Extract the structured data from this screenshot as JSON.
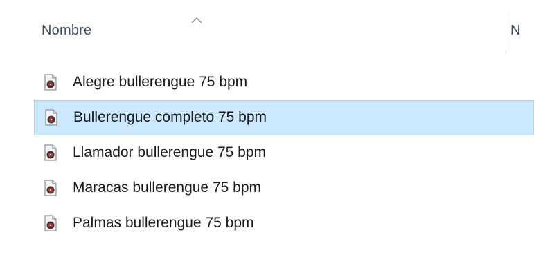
{
  "columns": {
    "name_header": "Nombre",
    "next_header": "N",
    "sort_indicator": "chevron-up-icon"
  },
  "files": [
    {
      "name": "Alegre bullerengue 75 bpm",
      "icon": "audio-file-icon",
      "selected": false
    },
    {
      "name": "Bullerengue completo 75 bpm",
      "icon": "audio-file-icon",
      "selected": true
    },
    {
      "name": "Llamador bullerengue 75 bpm",
      "icon": "audio-file-icon",
      "selected": false
    },
    {
      "name": "Maracas bullerengue 75 bpm",
      "icon": "audio-file-icon",
      "selected": false
    },
    {
      "name": "Palmas bullerengue 75 bpm",
      "icon": "audio-file-icon",
      "selected": false
    }
  ],
  "colors": {
    "selection_bg": "#cce8ff",
    "selection_border": "#99d1ff",
    "header_text": "#3a4a66",
    "icon_accent": "#c0392b"
  }
}
